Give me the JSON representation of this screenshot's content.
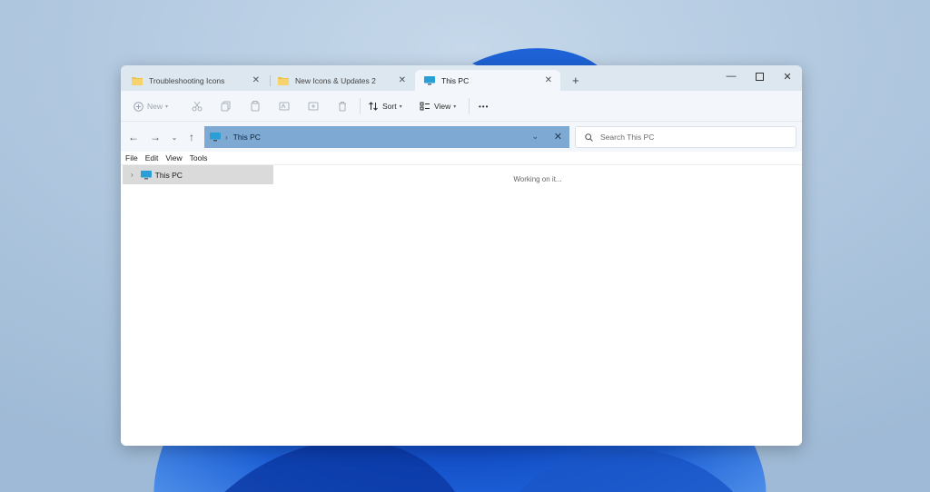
{
  "tabs": [
    {
      "label": "Troubleshooting Icons",
      "active": false
    },
    {
      "label": "New Icons & Updates 2",
      "active": false
    },
    {
      "label": "This PC",
      "active": true
    }
  ],
  "toolbar": {
    "new_label": "New",
    "sort_label": "Sort",
    "view_label": "View",
    "more_label": "•••"
  },
  "address": {
    "path": "This PC"
  },
  "search": {
    "placeholder": "Search This PC"
  },
  "menu": [
    "File",
    "Edit",
    "View",
    "Tools"
  ],
  "navpane": {
    "items": [
      {
        "label": "This PC"
      }
    ]
  },
  "content": {
    "status": "Working on it..."
  },
  "colors": {
    "address_highlight": "#7ea9d2",
    "tabbar_bg": "#dde7f0",
    "selection_bg": "#dadada"
  }
}
